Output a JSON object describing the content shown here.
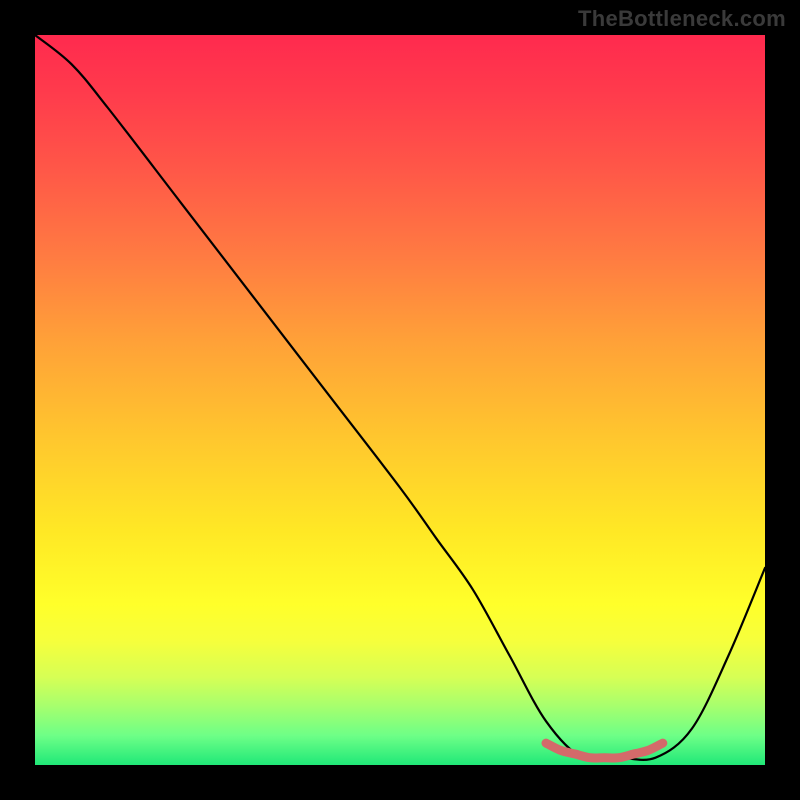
{
  "watermark": "TheBottleneck.com",
  "chart_data": {
    "type": "line",
    "title": "",
    "xlabel": "",
    "ylabel": "",
    "xlim": [
      0,
      100
    ],
    "ylim": [
      0,
      100
    ],
    "grid": false,
    "legend": false,
    "series": [
      {
        "name": "bottleneck-curve",
        "color": "#000000",
        "x": [
          0,
          5,
          10,
          20,
          30,
          40,
          50,
          55,
          60,
          65,
          70,
          75,
          80,
          85,
          90,
          95,
          100
        ],
        "values": [
          100,
          96,
          90,
          77,
          64,
          51,
          38,
          31,
          24,
          15,
          6,
          1,
          1,
          1,
          5,
          15,
          27
        ]
      },
      {
        "name": "optimal-range-marker",
        "color": "#d46a6a",
        "x": [
          70,
          72,
          74,
          76,
          78,
          80,
          82,
          84,
          86
        ],
        "values": [
          3,
          2,
          1.5,
          1,
          1,
          1,
          1.5,
          2,
          3
        ]
      }
    ],
    "background_gradient": {
      "top": "#ff2a4e",
      "mid": "#ffe825",
      "bottom": "#20e878"
    }
  }
}
